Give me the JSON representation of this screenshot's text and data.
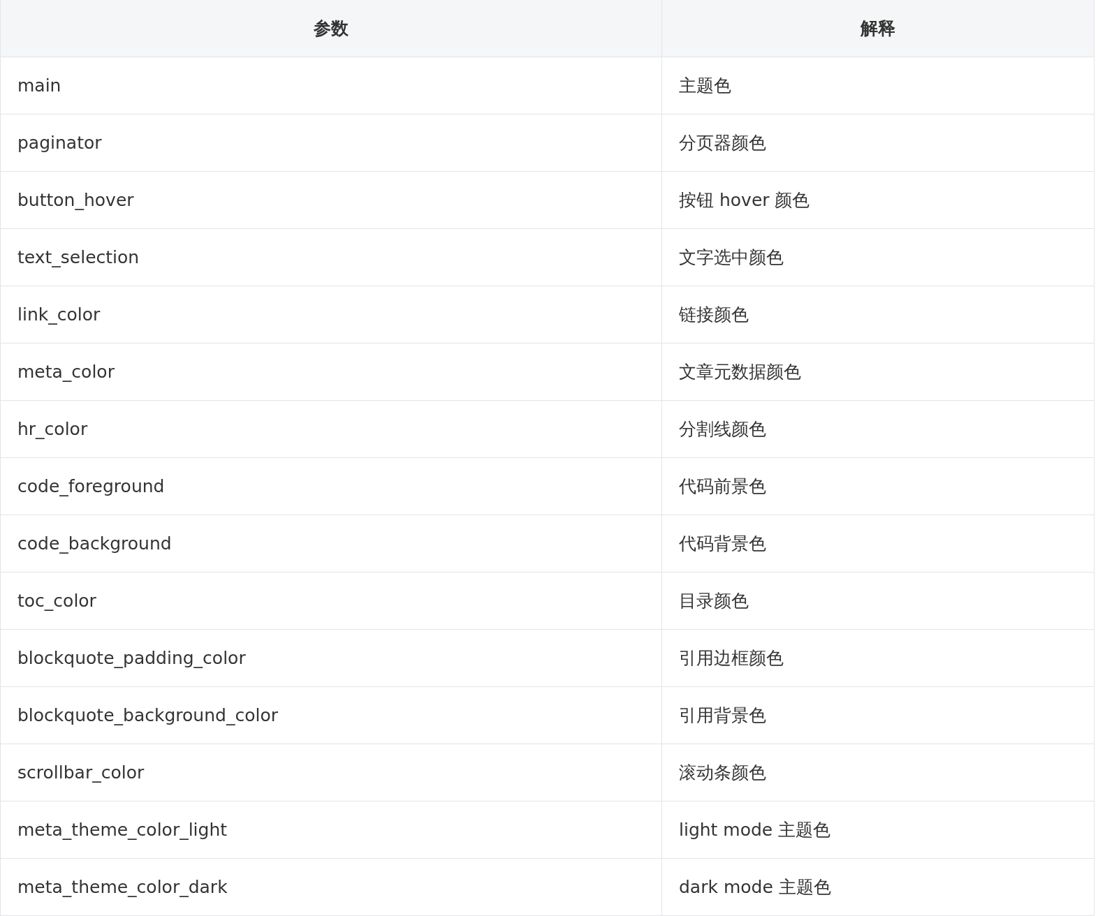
{
  "table": {
    "columns": [
      "参数",
      "解释"
    ],
    "rows": [
      [
        "main",
        "主题色"
      ],
      [
        "paginator",
        "分页器颜色"
      ],
      [
        "button_hover",
        "按钮 hover 颜色"
      ],
      [
        "text_selection",
        "文字选中颜色"
      ],
      [
        "link_color",
        "链接颜色"
      ],
      [
        "meta_color",
        "文章元数据颜色"
      ],
      [
        "hr_color",
        "分割线颜色"
      ],
      [
        "code_foreground",
        "代码前景色"
      ],
      [
        "code_background",
        "代码背景色"
      ],
      [
        "toc_color",
        "目录颜色"
      ],
      [
        "blockquote_padding_color",
        "引用边框颜色"
      ],
      [
        "blockquote_background_color",
        "引用背景色"
      ],
      [
        "scrollbar_color",
        "滚动条颜色"
      ],
      [
        "meta_theme_color_light",
        "light mode 主题色"
      ],
      [
        "meta_theme_color_dark",
        "dark mode 主题色"
      ]
    ]
  }
}
